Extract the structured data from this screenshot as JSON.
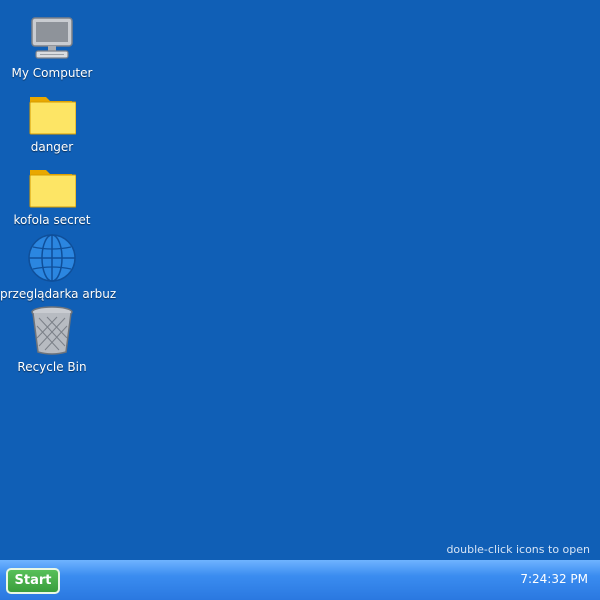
{
  "desktop": {
    "icons": [
      {
        "label": "My Computer",
        "icon": "computer-icon"
      },
      {
        "label": "danger",
        "icon": "folder-icon"
      },
      {
        "label": "kofola secret",
        "icon": "folder-icon"
      },
      {
        "label": "przeglądarka arbuz",
        "icon": "globe-icon"
      },
      {
        "label": "Recycle Bin",
        "icon": "recycle-bin-icon"
      }
    ],
    "hint": "double-click icons to open",
    "background_color": "#105fb6"
  },
  "taskbar": {
    "start_label": "Start",
    "clock": "7:24:32 PM"
  }
}
